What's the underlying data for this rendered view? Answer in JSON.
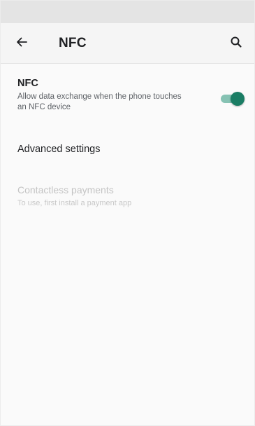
{
  "app_bar": {
    "title": "NFC",
    "back_icon": "arrow-back-icon",
    "search_icon": "search-icon"
  },
  "preferences": {
    "nfc": {
      "title": "NFC",
      "summary": "Allow data exchange when the phone touches an NFC device",
      "enabled": true
    },
    "advanced": {
      "title": "Advanced settings"
    },
    "payments": {
      "title": "Contactless payments",
      "summary": "To use, first install a payment app",
      "enabled": false
    }
  },
  "colors": {
    "accent": "#1a7d64",
    "accent_track": "#86c2b3",
    "disabled_text": "#c4c4c4"
  }
}
